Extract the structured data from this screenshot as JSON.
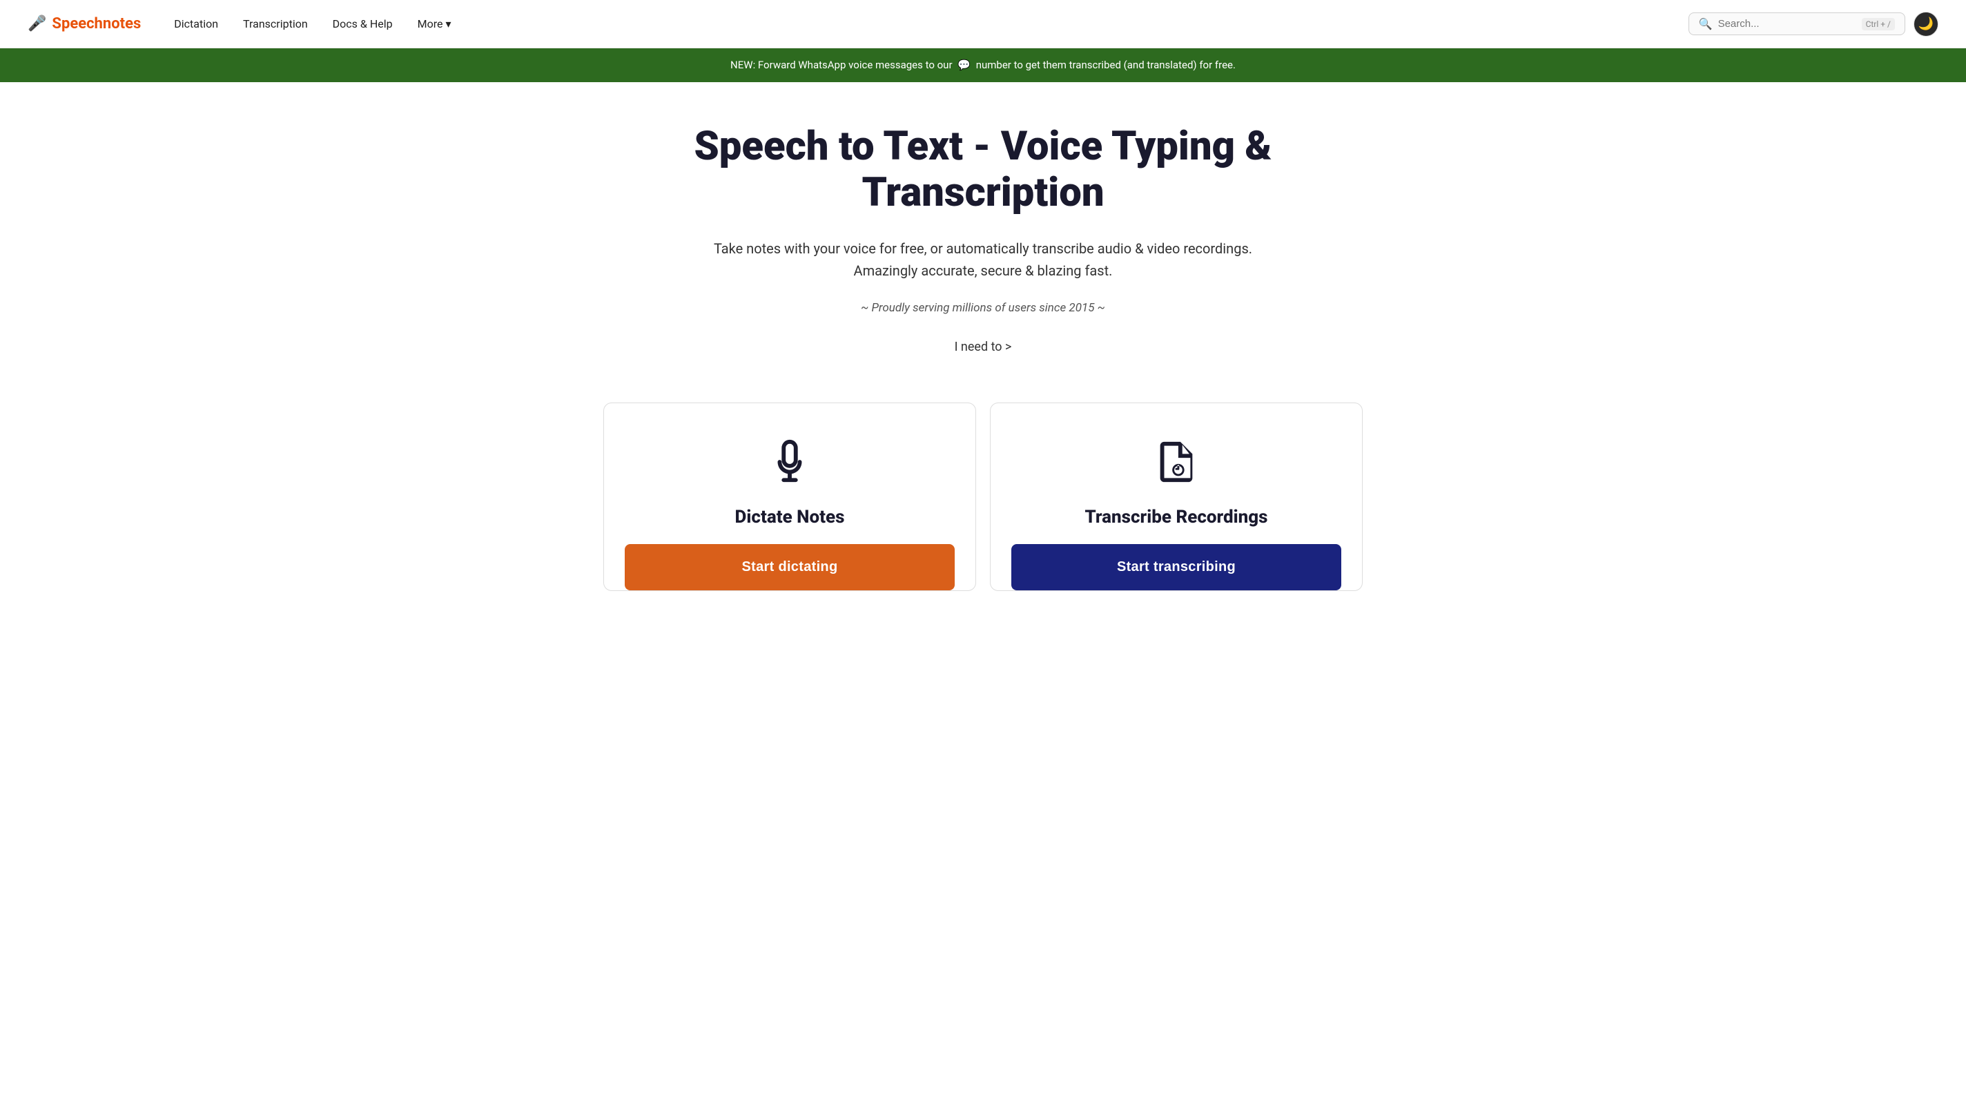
{
  "navbar": {
    "logo_icon": "🎤",
    "logo_text": "Speechnotes",
    "links": [
      {
        "id": "dictation",
        "label": "Dictation"
      },
      {
        "id": "transcription",
        "label": "Transcription"
      },
      {
        "id": "docs-help",
        "label": "Docs & Help"
      },
      {
        "id": "more",
        "label": "More",
        "has_dropdown": true
      }
    ],
    "search": {
      "placeholder": "Search...",
      "shortcut": "Ctrl + /"
    },
    "dark_mode_icon": "🌙"
  },
  "banner": {
    "text": "NEW: Forward WhatsApp voice messages to our",
    "whatsapp_icon": "💬",
    "text2": "number to get them transcribed (and translated) for free."
  },
  "hero": {
    "title": "Speech to Text - Voice Typing & Transcription",
    "subtitle_line1": "Take notes with your voice for free, or automatically transcribe audio & video recordings.",
    "subtitle_line2": "Amazingly accurate, secure & blazing fast.",
    "tagline": "~ Proudly serving millions of users since 2015 ~",
    "cta": "I need to >"
  },
  "cards": {
    "dictate": {
      "title": "Dictate Notes",
      "button_label": "Start dictating"
    },
    "transcribe": {
      "title": "Transcribe Recordings",
      "button_label": "Start transcribing"
    }
  },
  "colors": {
    "accent_orange": "#e8520a",
    "accent_dark": "#1a1a2e",
    "banner_green": "#2d6a1f",
    "button_orange": "#d95f1a",
    "button_blue": "#1a237e"
  }
}
